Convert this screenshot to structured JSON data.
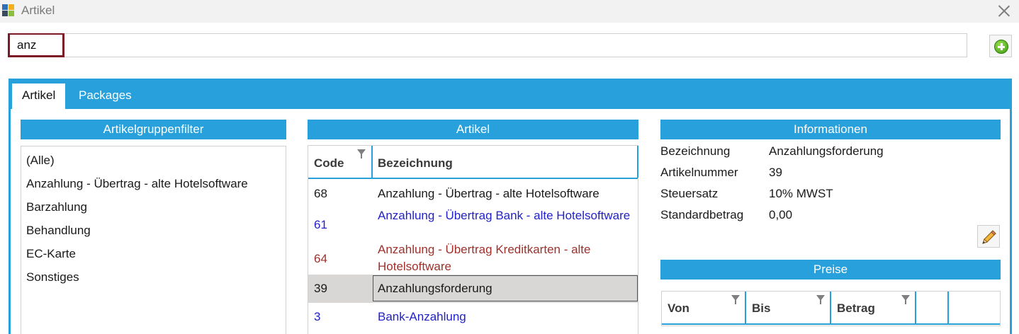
{
  "window": {
    "title": "Artikel",
    "close_icon": "close-icon"
  },
  "search": {
    "value": "anz",
    "placeholder": ""
  },
  "add_button": {
    "icon": "plus-circle-icon"
  },
  "tabs": [
    {
      "label": "Artikel",
      "active": true
    },
    {
      "label": "Packages",
      "active": false
    }
  ],
  "filter": {
    "header": "Artikelgruppenfilter",
    "items": [
      "(Alle)",
      "Anzahlung - Übertrag - alte Hotelsoftware",
      "Barzahlung",
      "Behandlung",
      "EC-Karte",
      "Sonstiges"
    ]
  },
  "articles": {
    "header": "Artikel",
    "columns": {
      "code": "Code",
      "name": "Bezeichnung"
    },
    "rows": [
      {
        "code": "68",
        "name": "Anzahlung - Übertrag - alte Hotelsoftware",
        "color": "#1a1a1a"
      },
      {
        "code": "61",
        "name": "Anzahlung - Übertrag Bank - alte Hotelsoftware",
        "color": "#2222c8"
      },
      {
        "code": "64",
        "name": "Anzahlung - Übertrag Kreditkarten - alte Hotelsoftware",
        "color": "#a0302a"
      },
      {
        "code": "39",
        "name": "Anzahlungsforderung",
        "color": "#1a1a1a",
        "selected": true
      },
      {
        "code": "3",
        "name": "Bank-Anzahlung",
        "color": "#2222c8"
      }
    ]
  },
  "info": {
    "header": "Informationen",
    "fields": [
      {
        "label": "Bezeichnung",
        "value": "Anzahlungsforderung"
      },
      {
        "label": "Artikelnummer",
        "value": "39"
      },
      {
        "label": "Steuersatz",
        "value": "10% MWST"
      },
      {
        "label": "Standardbetrag",
        "value": "0,00"
      }
    ],
    "edit_icon": "pencil-icon"
  },
  "prices": {
    "header": "Preise",
    "columns": {
      "from": "Von",
      "to": "Bis",
      "amount": "Betrag"
    }
  },
  "colors": {
    "accent": "#27a0dc",
    "search_border": "#7b1a24",
    "selected_row": "#d9d6d6"
  }
}
